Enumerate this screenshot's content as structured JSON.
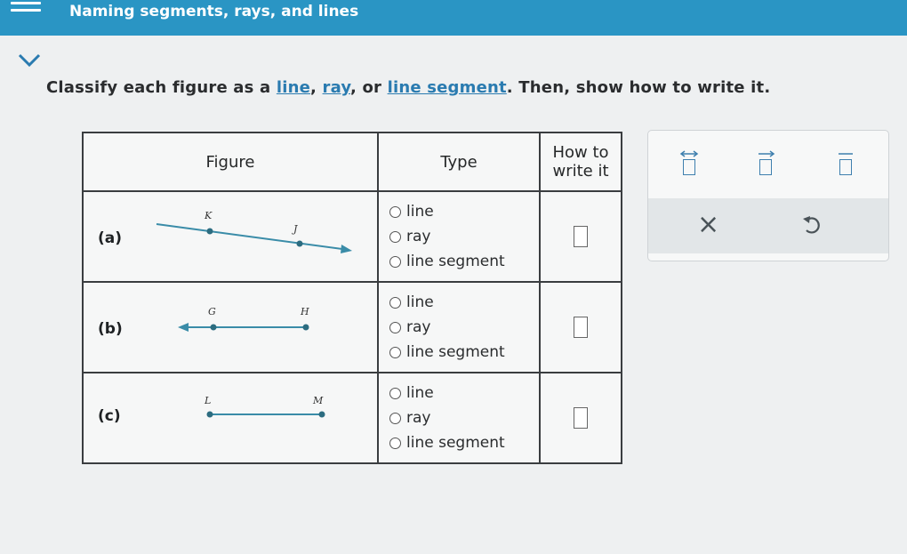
{
  "header": {
    "title": "Naming segments, rays, and lines"
  },
  "instructions": {
    "before": "Classify each figure as a ",
    "line": "line",
    "sep1": ", ",
    "ray": "ray",
    "sep2": ", or ",
    "segment": "line segment",
    "after": ". Then, show how to write it."
  },
  "table": {
    "headers": {
      "figure": "Figure",
      "type": "Type",
      "write_line1": "How to",
      "write_line2": "write it"
    },
    "rows": [
      {
        "label": "(a)",
        "points": [
          "K",
          "J"
        ],
        "options": [
          "line",
          "ray",
          "line segment"
        ]
      },
      {
        "label": "(b)",
        "points": [
          "G",
          "H"
        ],
        "options": [
          "line",
          "ray",
          "line segment"
        ]
      },
      {
        "label": "(c)",
        "points": [
          "L",
          "M"
        ],
        "options": [
          "line",
          "ray",
          "line segment"
        ]
      }
    ]
  },
  "tools": {
    "line_icon": "line-notation-icon",
    "ray_icon": "ray-notation-icon",
    "segment_icon": "segment-notation-icon",
    "clear_icon": "close-icon",
    "undo_icon": "undo-icon",
    "clear_symbol": "×"
  },
  "colors": {
    "header": "#2a95c4",
    "accent": "#3e7fae",
    "figure": "#3a8ca8"
  }
}
